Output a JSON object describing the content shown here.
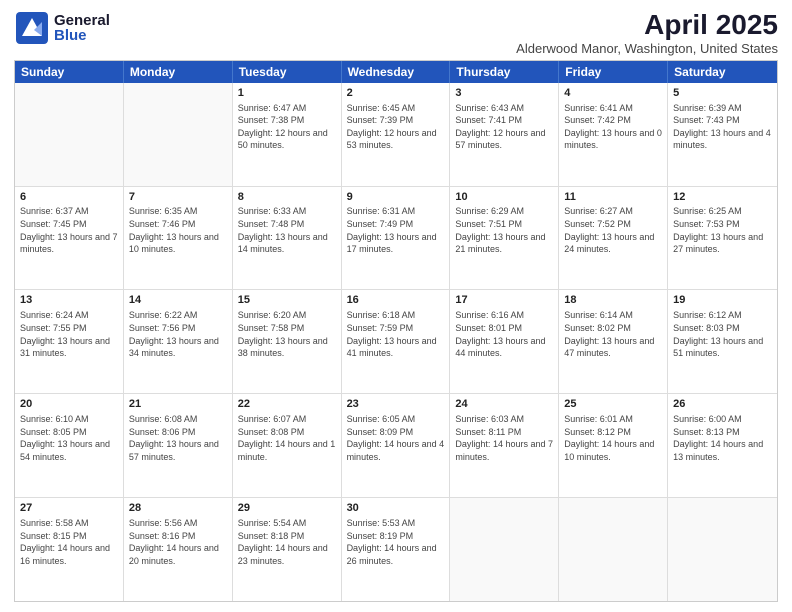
{
  "header": {
    "logo_general": "General",
    "logo_blue": "Blue",
    "month_year": "April 2025",
    "location": "Alderwood Manor, Washington, United States"
  },
  "days_of_week": [
    "Sunday",
    "Monday",
    "Tuesday",
    "Wednesday",
    "Thursday",
    "Friday",
    "Saturday"
  ],
  "weeks": [
    [
      {
        "day": "",
        "info": ""
      },
      {
        "day": "",
        "info": ""
      },
      {
        "day": "1",
        "info": "Sunrise: 6:47 AM\nSunset: 7:38 PM\nDaylight: 12 hours and 50 minutes."
      },
      {
        "day": "2",
        "info": "Sunrise: 6:45 AM\nSunset: 7:39 PM\nDaylight: 12 hours and 53 minutes."
      },
      {
        "day": "3",
        "info": "Sunrise: 6:43 AM\nSunset: 7:41 PM\nDaylight: 12 hours and 57 minutes."
      },
      {
        "day": "4",
        "info": "Sunrise: 6:41 AM\nSunset: 7:42 PM\nDaylight: 13 hours and 0 minutes."
      },
      {
        "day": "5",
        "info": "Sunrise: 6:39 AM\nSunset: 7:43 PM\nDaylight: 13 hours and 4 minutes."
      }
    ],
    [
      {
        "day": "6",
        "info": "Sunrise: 6:37 AM\nSunset: 7:45 PM\nDaylight: 13 hours and 7 minutes."
      },
      {
        "day": "7",
        "info": "Sunrise: 6:35 AM\nSunset: 7:46 PM\nDaylight: 13 hours and 10 minutes."
      },
      {
        "day": "8",
        "info": "Sunrise: 6:33 AM\nSunset: 7:48 PM\nDaylight: 13 hours and 14 minutes."
      },
      {
        "day": "9",
        "info": "Sunrise: 6:31 AM\nSunset: 7:49 PM\nDaylight: 13 hours and 17 minutes."
      },
      {
        "day": "10",
        "info": "Sunrise: 6:29 AM\nSunset: 7:51 PM\nDaylight: 13 hours and 21 minutes."
      },
      {
        "day": "11",
        "info": "Sunrise: 6:27 AM\nSunset: 7:52 PM\nDaylight: 13 hours and 24 minutes."
      },
      {
        "day": "12",
        "info": "Sunrise: 6:25 AM\nSunset: 7:53 PM\nDaylight: 13 hours and 27 minutes."
      }
    ],
    [
      {
        "day": "13",
        "info": "Sunrise: 6:24 AM\nSunset: 7:55 PM\nDaylight: 13 hours and 31 minutes."
      },
      {
        "day": "14",
        "info": "Sunrise: 6:22 AM\nSunset: 7:56 PM\nDaylight: 13 hours and 34 minutes."
      },
      {
        "day": "15",
        "info": "Sunrise: 6:20 AM\nSunset: 7:58 PM\nDaylight: 13 hours and 38 minutes."
      },
      {
        "day": "16",
        "info": "Sunrise: 6:18 AM\nSunset: 7:59 PM\nDaylight: 13 hours and 41 minutes."
      },
      {
        "day": "17",
        "info": "Sunrise: 6:16 AM\nSunset: 8:01 PM\nDaylight: 13 hours and 44 minutes."
      },
      {
        "day": "18",
        "info": "Sunrise: 6:14 AM\nSunset: 8:02 PM\nDaylight: 13 hours and 47 minutes."
      },
      {
        "day": "19",
        "info": "Sunrise: 6:12 AM\nSunset: 8:03 PM\nDaylight: 13 hours and 51 minutes."
      }
    ],
    [
      {
        "day": "20",
        "info": "Sunrise: 6:10 AM\nSunset: 8:05 PM\nDaylight: 13 hours and 54 minutes."
      },
      {
        "day": "21",
        "info": "Sunrise: 6:08 AM\nSunset: 8:06 PM\nDaylight: 13 hours and 57 minutes."
      },
      {
        "day": "22",
        "info": "Sunrise: 6:07 AM\nSunset: 8:08 PM\nDaylight: 14 hours and 1 minute."
      },
      {
        "day": "23",
        "info": "Sunrise: 6:05 AM\nSunset: 8:09 PM\nDaylight: 14 hours and 4 minutes."
      },
      {
        "day": "24",
        "info": "Sunrise: 6:03 AM\nSunset: 8:11 PM\nDaylight: 14 hours and 7 minutes."
      },
      {
        "day": "25",
        "info": "Sunrise: 6:01 AM\nSunset: 8:12 PM\nDaylight: 14 hours and 10 minutes."
      },
      {
        "day": "26",
        "info": "Sunrise: 6:00 AM\nSunset: 8:13 PM\nDaylight: 14 hours and 13 minutes."
      }
    ],
    [
      {
        "day": "27",
        "info": "Sunrise: 5:58 AM\nSunset: 8:15 PM\nDaylight: 14 hours and 16 minutes."
      },
      {
        "day": "28",
        "info": "Sunrise: 5:56 AM\nSunset: 8:16 PM\nDaylight: 14 hours and 20 minutes."
      },
      {
        "day": "29",
        "info": "Sunrise: 5:54 AM\nSunset: 8:18 PM\nDaylight: 14 hours and 23 minutes."
      },
      {
        "day": "30",
        "info": "Sunrise: 5:53 AM\nSunset: 8:19 PM\nDaylight: 14 hours and 26 minutes."
      },
      {
        "day": "",
        "info": ""
      },
      {
        "day": "",
        "info": ""
      },
      {
        "day": "",
        "info": ""
      }
    ]
  ]
}
